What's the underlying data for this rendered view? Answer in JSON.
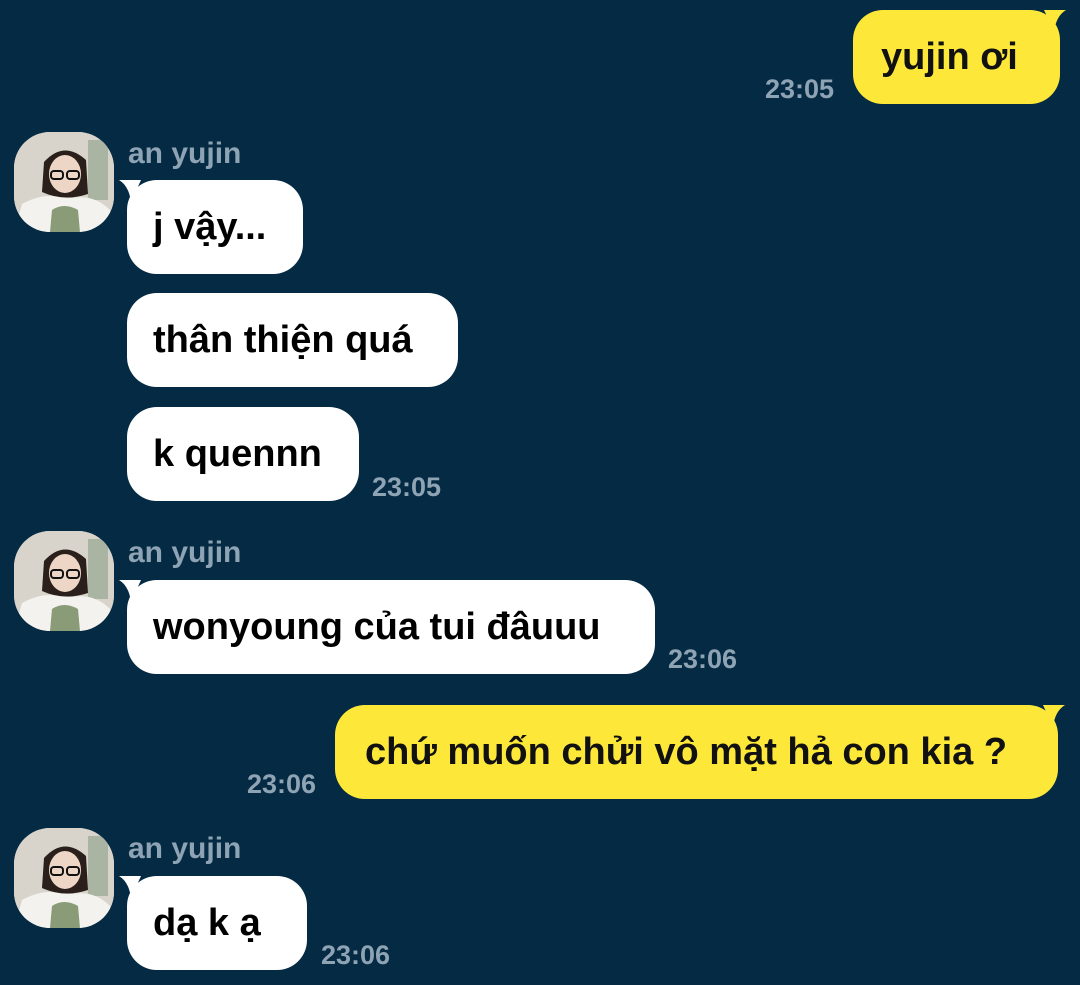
{
  "chat": {
    "messages": [
      {
        "direction": "out",
        "text": "yujin ơi",
        "time": "23:05"
      },
      {
        "direction": "in",
        "sender": "an yujin",
        "text": "j vậy..."
      },
      {
        "direction": "in",
        "text": "thân thiện quá"
      },
      {
        "direction": "in",
        "text": "k quennn",
        "time": "23:05"
      },
      {
        "direction": "in",
        "sender": "an yujin",
        "text": "wonyoung của tui đâuuu",
        "time": "23:06"
      },
      {
        "direction": "out",
        "text": "chứ muốn chửi vô mặt hả con kia ?",
        "time": "23:06"
      },
      {
        "direction": "in",
        "sender": "an yujin",
        "text": "dạ k ạ",
        "time": "23:06"
      }
    ]
  },
  "colors": {
    "background": "#052a43",
    "outgoing_bubble": "#fde83a",
    "incoming_bubble": "#ffffff",
    "meta_text": "#8ea3b3"
  },
  "icons": {
    "avatar": "profile-photo"
  }
}
